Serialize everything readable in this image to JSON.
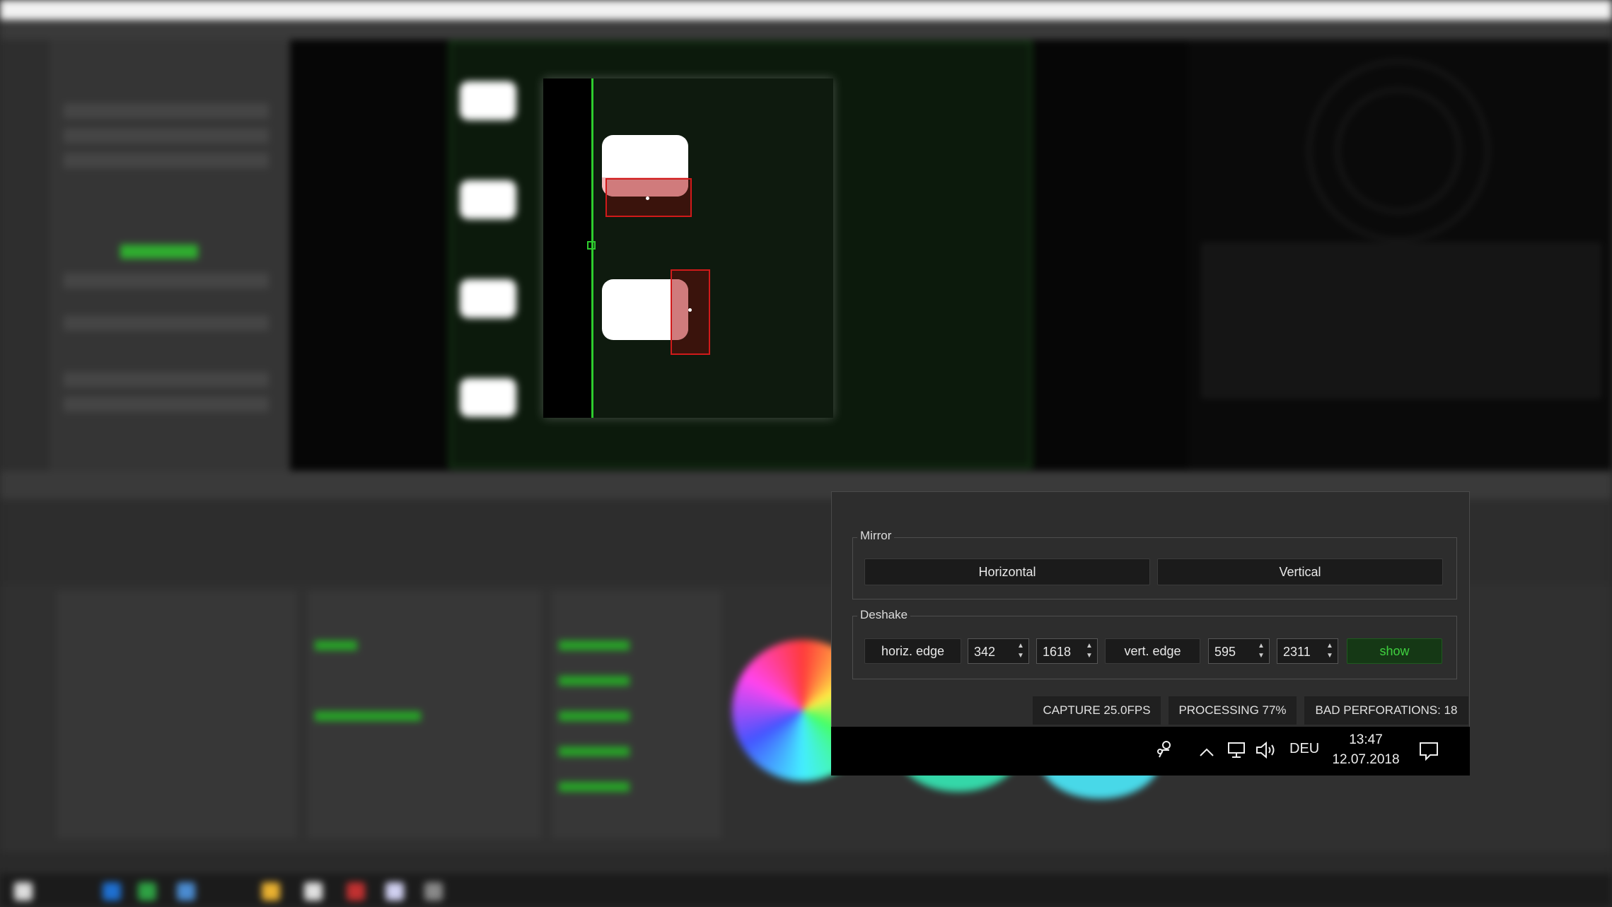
{
  "mirror": {
    "title": "Mirror",
    "horizontal_label": "Horizontal",
    "vertical_label": "Vertical"
  },
  "deshake": {
    "title": "Deshake",
    "horiz_edge_label": "horiz. edge",
    "horiz_edge_min": "342",
    "horiz_edge_max": "1618",
    "vert_edge_label": "vert. edge",
    "vert_edge_min": "595",
    "vert_edge_max": "2311",
    "show_label": "show"
  },
  "status": {
    "capture": "CAPTURE 25.0FPS",
    "processing": "PROCESSING 77%",
    "bad_perforations": "BAD PERFORATIONS: 18"
  },
  "tray": {
    "language": "DEU",
    "time": "13:47",
    "date": "12.07.2018"
  },
  "icons": {
    "people": "people-icon",
    "chevron": "chevron-up-icon",
    "network": "network-icon",
    "volume": "volume-icon",
    "notifications": "notification-icon"
  },
  "colors": {
    "accent_green": "#2ecb2e",
    "mark_red": "#d01a1a",
    "dialog_bg": "#2d2d2d"
  }
}
